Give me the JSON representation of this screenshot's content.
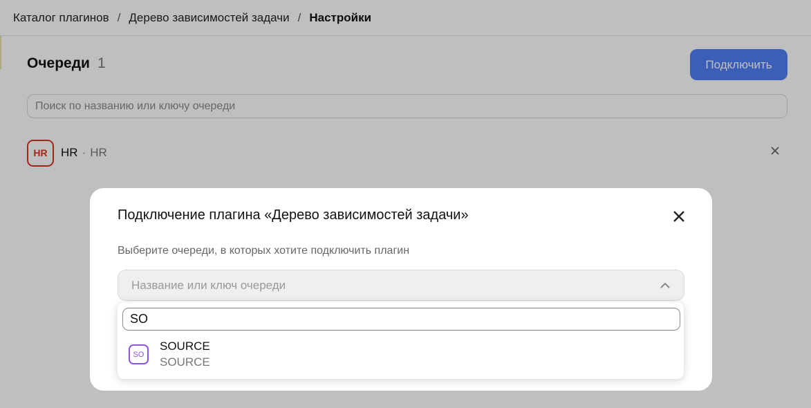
{
  "breadcrumbs": {
    "items": [
      "Каталог плагинов",
      "Дерево зависимостей задачи",
      "Настройки"
    ],
    "separator": "/"
  },
  "queues": {
    "title": "Очереди",
    "count": "1",
    "connect_label": "Подключить",
    "search_placeholder": "Поиск по названию или ключу очереди",
    "items": [
      {
        "badge": "HR",
        "name": "HR",
        "separator": "·",
        "key": "HR",
        "badge_color": "#d93025"
      }
    ]
  },
  "modal": {
    "title": "Подключение плагина «Дерево зависимостей задачи»",
    "subtitle": "Выберите очереди, в которых хотите подключить плагин",
    "select_placeholder": "Название или ключ очереди",
    "dropdown": {
      "search_value": "SO",
      "options": [
        {
          "badge": "SO",
          "name": "SOURCE",
          "key": "SOURCE",
          "badge_color": "#8b55e0"
        }
      ]
    }
  },
  "colors": {
    "accent": "#4f7ff5",
    "overlay": "rgba(0,0,0,0.25)"
  }
}
